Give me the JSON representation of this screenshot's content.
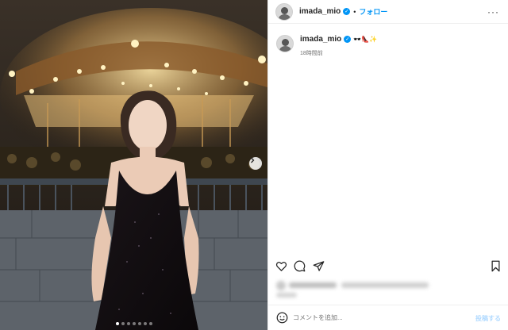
{
  "account": {
    "username": "imada_mio",
    "separator": "•",
    "follow_label": "フォロー",
    "verified_glyph": "✓",
    "more_glyph": "···"
  },
  "caption": {
    "username": "imada_mio",
    "emojis": "🕶️👠✨",
    "timestamp": "18時間前"
  },
  "carousel": {
    "dot_count": 7,
    "active_index": 0
  },
  "comment": {
    "placeholder": "コメントを追加...",
    "post_label": "投稿する"
  },
  "colors": {
    "accent": "#0095f6",
    "text": "#262626",
    "muted": "#737373",
    "divider": "#efefef"
  },
  "icons": [
    "heart-icon",
    "comment-icon",
    "share-icon",
    "bookmark-icon",
    "emoji-icon",
    "more-icon",
    "chevron-right-icon",
    "verified-icon"
  ]
}
